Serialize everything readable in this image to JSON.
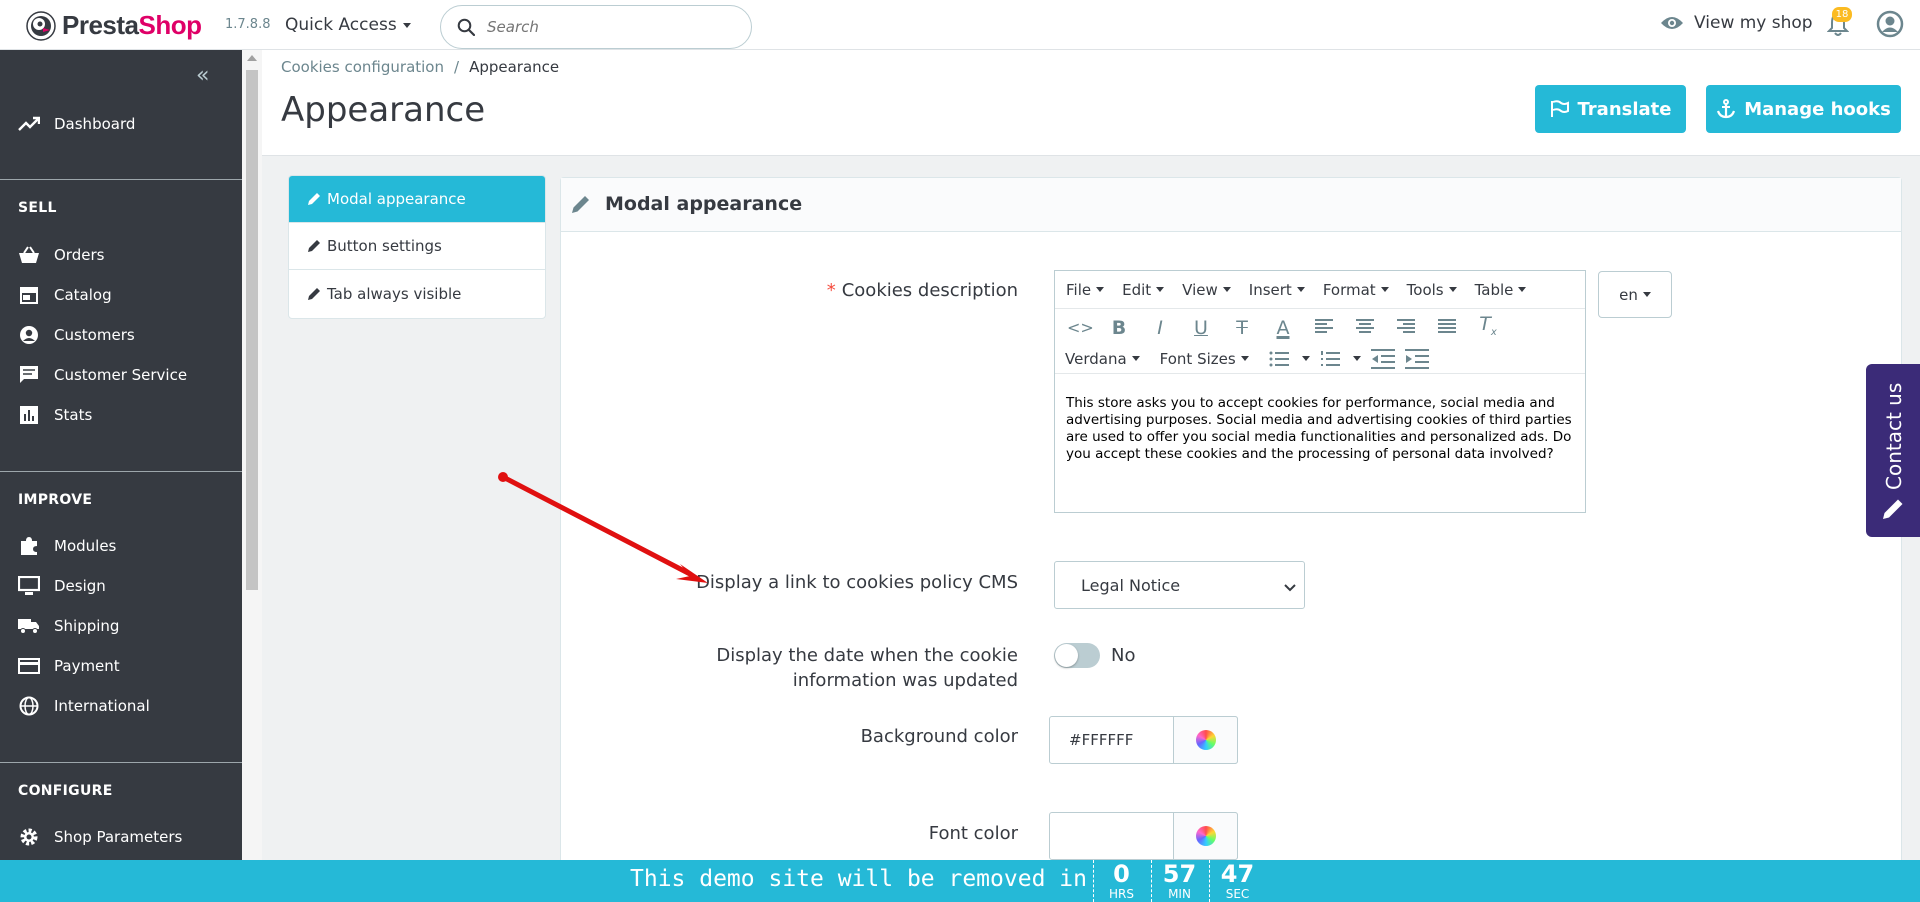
{
  "header": {
    "logo_part1": "Presta",
    "logo_part2": "Shop",
    "version": "1.7.8.8",
    "quick_access": "Quick Access",
    "search_placeholder": "Search",
    "view_shop": "View my shop",
    "notifications_count": "18"
  },
  "sidebar": {
    "dashboard": "Dashboard",
    "sections": {
      "sell": "SELL",
      "improve": "IMPROVE",
      "configure": "CONFIGURE"
    },
    "sell_items": [
      "Orders",
      "Catalog",
      "Customers",
      "Customer Service",
      "Stats"
    ],
    "improve_items": [
      "Modules",
      "Design",
      "Shipping",
      "Payment",
      "International"
    ],
    "configure_items": [
      "Shop Parameters"
    ]
  },
  "page": {
    "breadcrumb_parent": "Cookies configuration",
    "breadcrumb_sep": "/",
    "breadcrumb_current": "Appearance",
    "title": "Appearance",
    "translate_button": "Translate",
    "hooks_button": "Manage hooks"
  },
  "tabs": [
    "Modal appearance",
    "Button settings",
    "Tab always visible"
  ],
  "panel": {
    "title": "Modal appearance",
    "cookies_description_label": "Cookies description",
    "editor_menu": [
      "File",
      "Edit",
      "View",
      "Insert",
      "Format",
      "Tools",
      "Table"
    ],
    "font_family": "Verdana",
    "font_sizes": "Font Sizes",
    "editor_text": "This store asks you to accept cookies for performance, social media and advertising purposes. Social media and advertising cookies of third parties are used to offer you social media functionalities and personalized ads. Do you accept these cookies and the processing of personal data involved?",
    "language": "en",
    "cms_link_label": "Display a link to cookies policy CMS",
    "cms_selected": "Legal Notice",
    "date_label_line1": "Display the date when the cookie",
    "date_label_line2": "information was updated",
    "date_switch_value": "No",
    "bg_color_label": "Background color",
    "bg_color_value": "#FFFFFF",
    "font_color_label": "Font color",
    "font_color_value": ""
  },
  "contact_tab": "Contact us",
  "demo": {
    "message": "This demo site will be removed in",
    "hours": "0",
    "hours_unit": "HRS",
    "minutes": "57",
    "minutes_unit": "MIN",
    "seconds": "47",
    "seconds_unit": "SEC"
  },
  "colors": {
    "accent": "#25b9d7",
    "sidebar_bg": "#363a41",
    "brand_pink": "#df0067",
    "contact_bg": "#3b2b78",
    "arrow_red": "#e01010"
  }
}
